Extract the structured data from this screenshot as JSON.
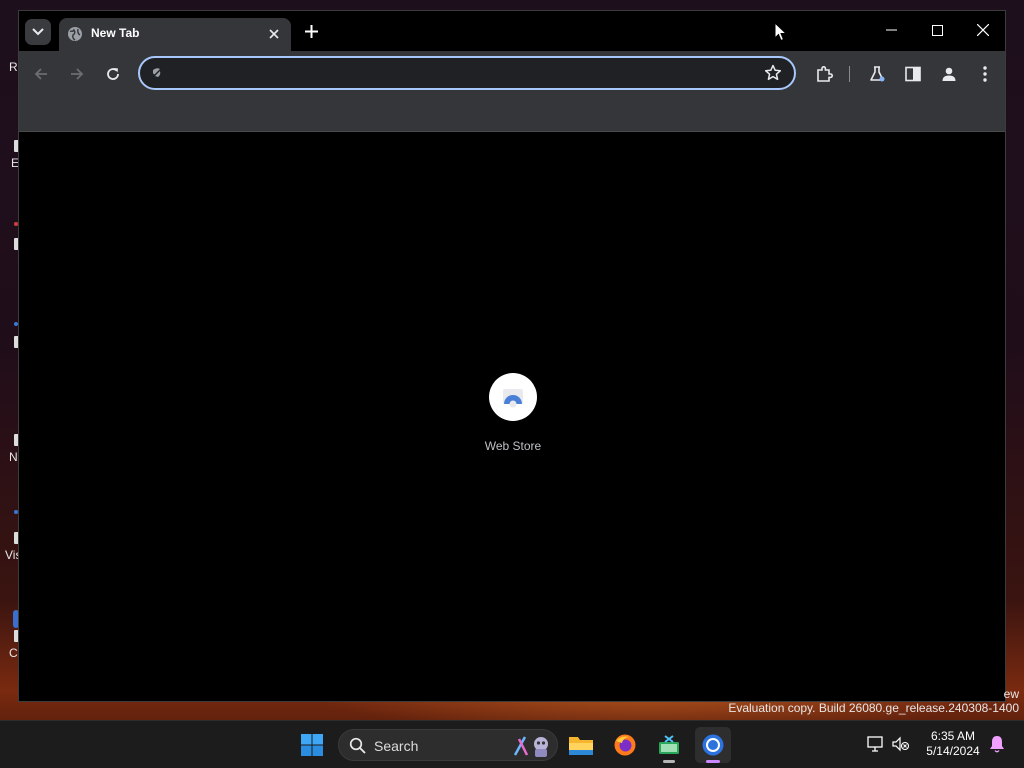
{
  "desktop": {
    "icons": [
      {
        "label": "R"
      },
      {
        "label": "E"
      },
      {
        "label": ""
      },
      {
        "label": ""
      },
      {
        "label": "N"
      },
      {
        "label": "Vis"
      },
      {
        "label": "C"
      }
    ],
    "watermark_line1": "ew",
    "watermark_line2": "Evaluation copy. Build 26080.ge_release.240308-1400"
  },
  "browser": {
    "tab": {
      "title": "New Tab"
    },
    "omnibox": {
      "value": "",
      "placeholder": ""
    },
    "shortcuts": [
      {
        "label": "Web Store",
        "icon": "web-store-icon"
      }
    ],
    "colors": {
      "accent": "#a8c7fa",
      "toolbar": "#35363a",
      "background": "#000000"
    }
  },
  "taskbar": {
    "search_label": "Search",
    "apps": [
      "start-icon",
      "file-explorer-icon",
      "firefox-icon",
      "app-icon",
      "chrome-icon"
    ],
    "clock": {
      "time": "6:35 AM",
      "date": "5/14/2024"
    }
  }
}
